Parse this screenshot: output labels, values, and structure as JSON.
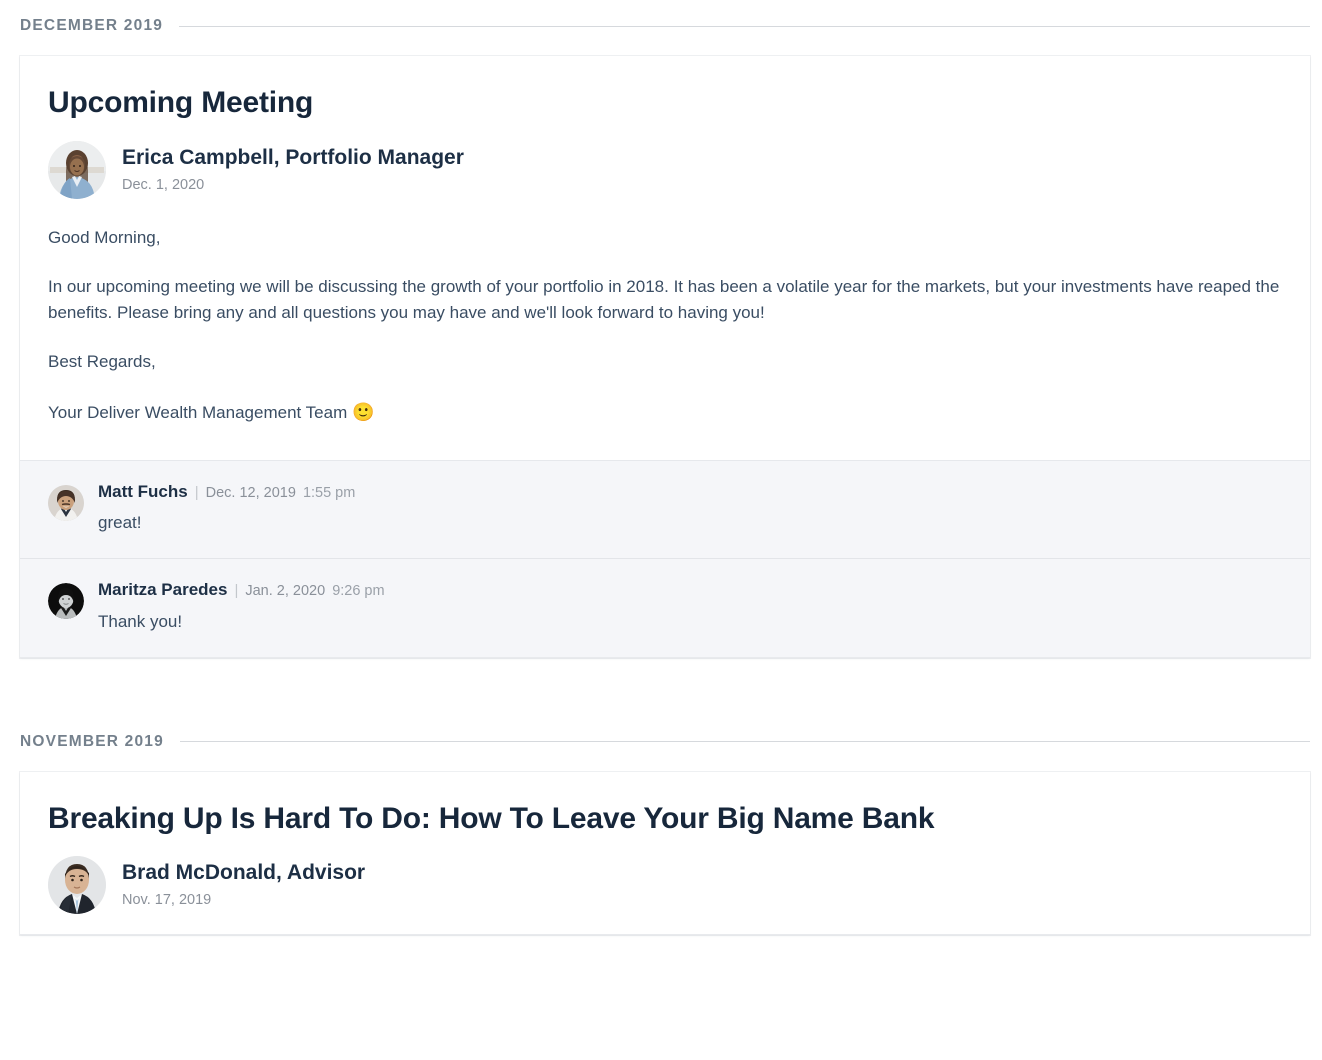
{
  "feed": {
    "sections": [
      {
        "month_label": "DECEMBER 2019",
        "post": {
          "title": "Upcoming Meeting",
          "author_name": "Erica Campbell, Portfolio Manager",
          "author_date": "Dec. 1, 2020",
          "avatar_name": "avatar-erica-campbell",
          "paragraphs": [
            "Good Morning,",
            "In our upcoming meeting we will be discussing the growth of your portfolio in 2018. It has been a volatile year for the markets, but your investments have reaped the benefits. Please bring any and all questions you may have and we'll look forward to having you!",
            "Best Regards,",
            "Your Deliver Wealth Management Team"
          ],
          "signoff_emoji": "🙂",
          "comments": [
            {
              "name": "Matt Fuchs",
              "separator": "|",
              "date": "Dec. 12, 2019",
              "time": "1:55 pm",
              "text": "great!",
              "avatar_name": "avatar-matt-fuchs"
            },
            {
              "name": "Maritza Paredes",
              "separator": "|",
              "date": "Jan. 2, 2020",
              "time": "9:26 pm",
              "text": "Thank you!",
              "avatar_name": "avatar-maritza-paredes"
            }
          ]
        }
      },
      {
        "month_label": "NOVEMBER 2019",
        "post": {
          "title": "Breaking Up Is Hard To Do: How To Leave Your Big Name Bank",
          "author_name": "Brad McDonald, Advisor",
          "author_date": "Nov. 17, 2019",
          "avatar_name": "avatar-brad-mcdonald",
          "paragraphs": [],
          "comments": []
        }
      }
    ]
  },
  "colors": {
    "month_label": "#74808c",
    "rule": "#d6d9dd",
    "title": "#17273b",
    "body_text": "#3a4d63",
    "muted": "#8a9099",
    "comment_bg": "#f5f6f9",
    "card_bg": "#ffffff"
  }
}
